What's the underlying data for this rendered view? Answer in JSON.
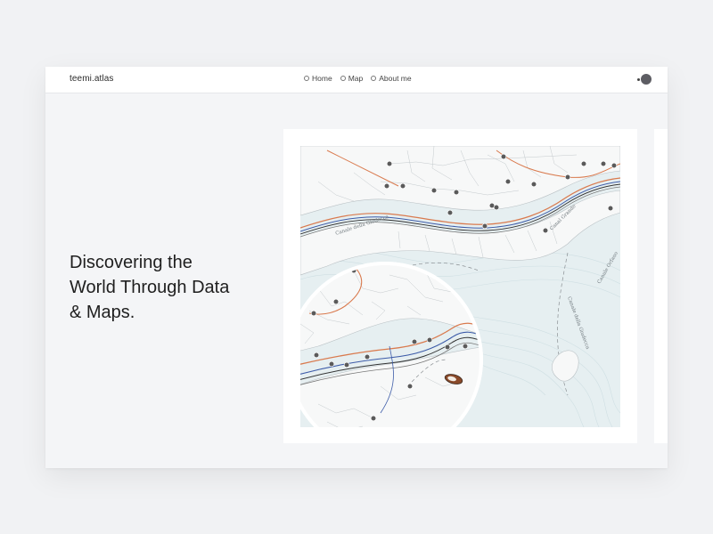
{
  "brand": {
    "name": "teemi.atlas"
  },
  "nav": {
    "links": [
      {
        "label": "Home"
      },
      {
        "label": "Map"
      },
      {
        "label": "About me"
      }
    ]
  },
  "hero": {
    "lines": [
      "Discovering the",
      "World Through Data",
      "& Maps."
    ]
  },
  "map": {
    "labels": [
      "Canale della Giudecca",
      "Canal Grande",
      "Canale della Giudecca",
      "Canale Orfano"
    ]
  },
  "colors": {
    "background": "#f1f2f4",
    "card": "#ffffff",
    "water": "#d7e6ea",
    "land": "#f7f8f8",
    "route_orange": "#d97a4e",
    "route_blue": "#3c5ba8",
    "route_dark": "#333333",
    "station": "#5a5a5a"
  }
}
